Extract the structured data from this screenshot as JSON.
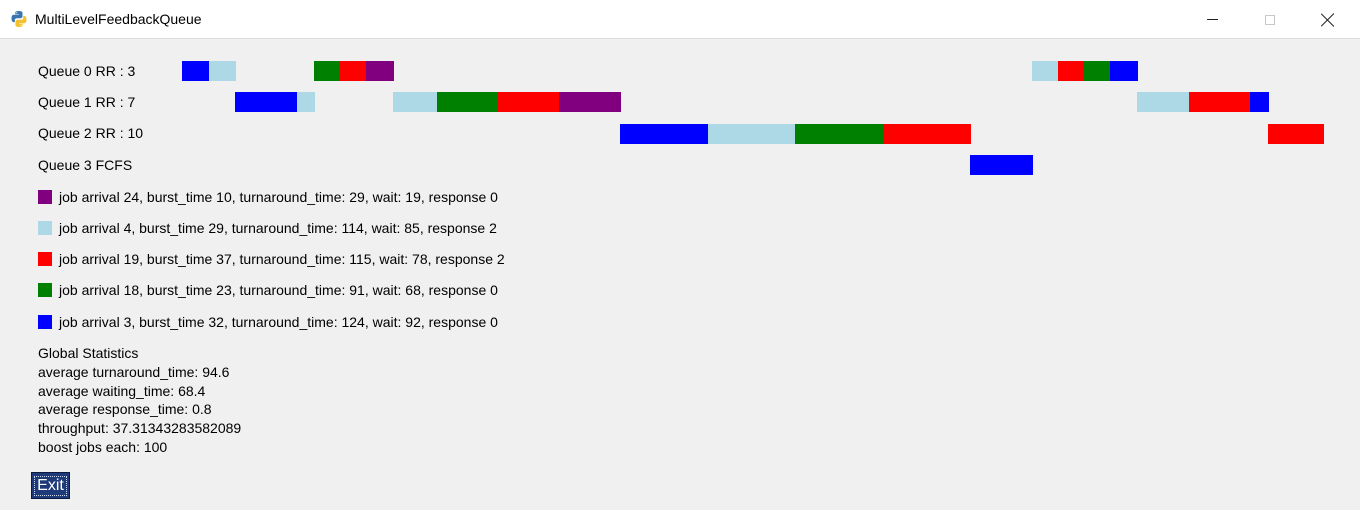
{
  "window": {
    "title": "MultiLevelFeedbackQueue",
    "controls": [
      "minimize",
      "maximize",
      "close"
    ]
  },
  "queues": [
    {
      "label": "Queue 0 RR : 3"
    },
    {
      "label": "Queue 1 RR : 7"
    },
    {
      "label": "Queue 2 RR : 10"
    },
    {
      "label": "Queue 3 FCFS"
    }
  ],
  "colors": {
    "purple": "#800080",
    "lightblue": "#add8e6",
    "red": "#ff0000",
    "green": "#008000",
    "blue": "#0000ff"
  },
  "jobs": [
    {
      "color": "#800080",
      "text": "job arrival 24, burst_time 10, turnaround_time: 29, wait: 19, response 0"
    },
    {
      "color": "#add8e6",
      "text": "job arrival 4, burst_time 29, turnaround_time: 114, wait: 85, response 2"
    },
    {
      "color": "#ff0000",
      "text": "job arrival 19, burst_time 37, turnaround_time: 115, wait: 78, response 2"
    },
    {
      "color": "#008000",
      "text": "job arrival 18, burst_time 23, turnaround_time: 91, wait: 68, response 0"
    },
    {
      "color": "#0000ff",
      "text": "job arrival 3, burst_time 32, turnaround_time: 124, wait: 92, response 0"
    }
  ],
  "stats": {
    "heading": "Global Statistics",
    "avg_turnaround": "average turnaround_time: 94.6",
    "avg_waiting": "average waiting_time: 68.4",
    "avg_response": "average response_time: 0.8",
    "throughput": "throughput: 37.31343283582089",
    "boost": "boost jobs each: 100"
  },
  "exit_label": "Exit"
}
